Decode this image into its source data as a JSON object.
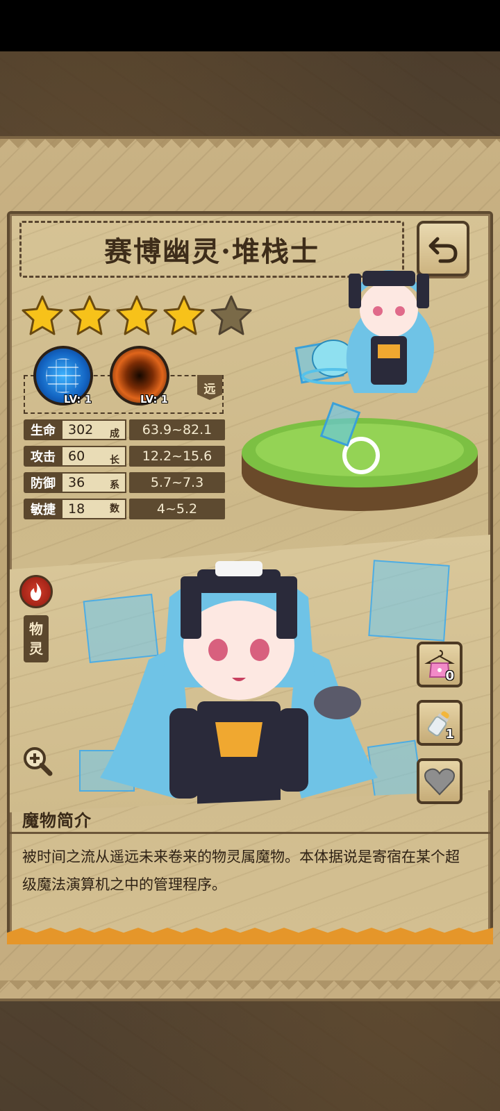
{
  "monster": {
    "name": "赛博幽灵·堆栈士",
    "stars_filled": 4,
    "stars_total": 5,
    "type_label_1": "物",
    "type_label_2": "灵",
    "range_label": "远"
  },
  "skills": [
    {
      "name": "skill-1",
      "level_label": "LV: 1",
      "color": "#1364c2"
    },
    {
      "name": "skill-2",
      "level_label": "LV: 1",
      "color": "#e0651b"
    }
  ],
  "stats": [
    {
      "label": "生命",
      "value": "302",
      "growth": "63.9~82.1"
    },
    {
      "label": "攻击",
      "value": "60",
      "growth": "12.2~15.6"
    },
    {
      "label": "防御",
      "value": "36",
      "growth": "5.7~7.3"
    },
    {
      "label": "敏捷",
      "value": "18",
      "growth": "4~5.2"
    }
  ],
  "growth_label": [
    "成",
    "长",
    "系",
    "数"
  ],
  "side_buttons": {
    "outfit_count": "0",
    "bottle_count": "1"
  },
  "intro": {
    "title": "魔物简介",
    "text": "被时间之流从遥远未来卷来的物灵属魔物。本体据说是寄宿在某个超级魔法演算机之中的管理程序。"
  },
  "colors": {
    "panel": "#cdb98a",
    "dark_brown": "#5b472d",
    "hair": "#6fc3e6",
    "grass": "#7cc043"
  }
}
